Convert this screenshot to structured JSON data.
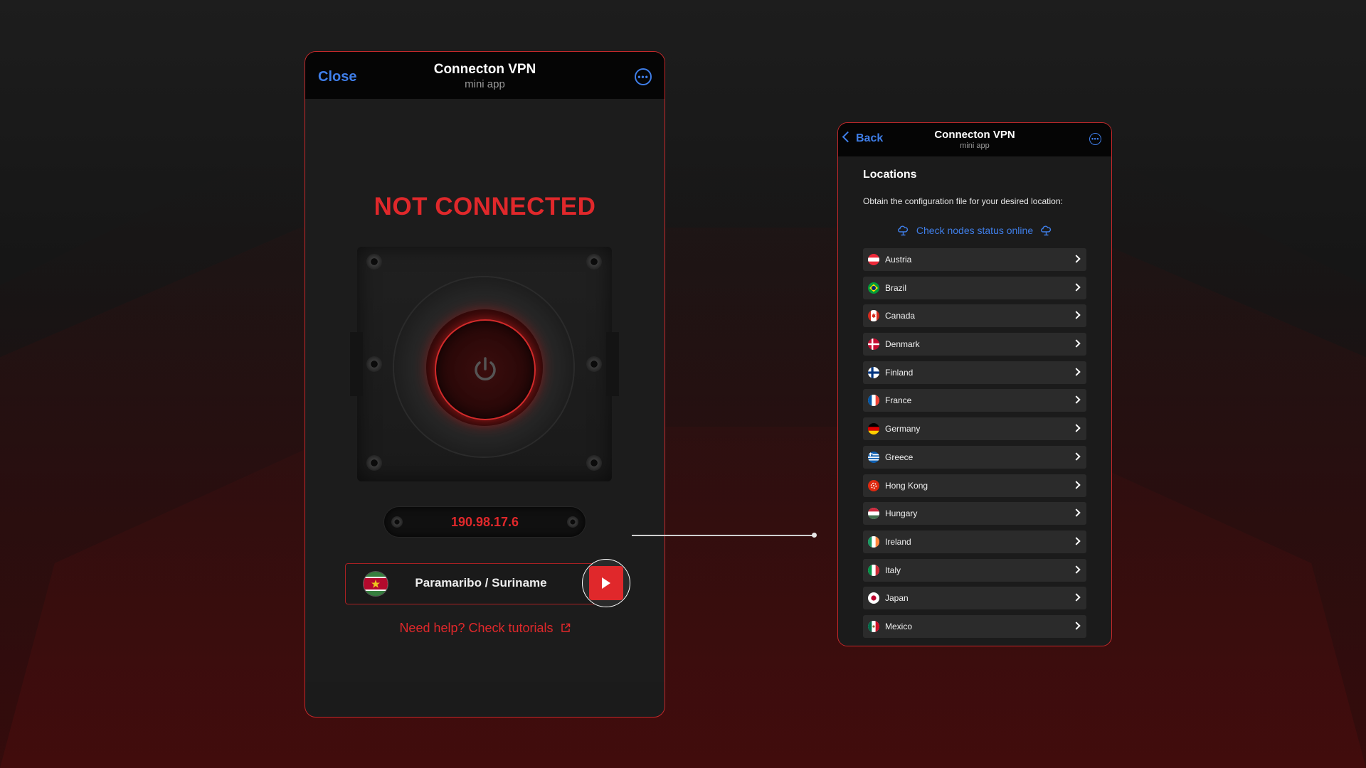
{
  "main": {
    "close_label": "Close",
    "title": "Connecton VPN",
    "subtitle": "mini app",
    "status": "NOT CONNECTED",
    "ip": "190.98.17.6",
    "location": "Paramaribo / Suriname",
    "help": "Need help? Check tutorials"
  },
  "locations_screen": {
    "back_label": "Back",
    "title": "Connecton VPN",
    "subtitle": "mini app",
    "heading": "Locations",
    "description": "Obtain the configuration file for your desired location:",
    "check_nodes": "Check nodes status online",
    "items": [
      {
        "name": "Austria",
        "flag": "austria"
      },
      {
        "name": "Brazil",
        "flag": "brazil"
      },
      {
        "name": "Canada",
        "flag": "canada"
      },
      {
        "name": "Denmark",
        "flag": "denmark"
      },
      {
        "name": "Finland",
        "flag": "finland"
      },
      {
        "name": "France",
        "flag": "france"
      },
      {
        "name": "Germany",
        "flag": "germany"
      },
      {
        "name": "Greece",
        "flag": "greece"
      },
      {
        "name": "Hong Kong",
        "flag": "hong-kong"
      },
      {
        "name": "Hungary",
        "flag": "hungary"
      },
      {
        "name": "Ireland",
        "flag": "ireland"
      },
      {
        "name": "Italy",
        "flag": "italy"
      },
      {
        "name": "Japan",
        "flag": "japan"
      },
      {
        "name": "Mexico",
        "flag": "mexico"
      }
    ]
  },
  "colors": {
    "accent_red": "#e0282b",
    "link_blue": "#3f7ee8",
    "border_red": "#c4282a"
  }
}
